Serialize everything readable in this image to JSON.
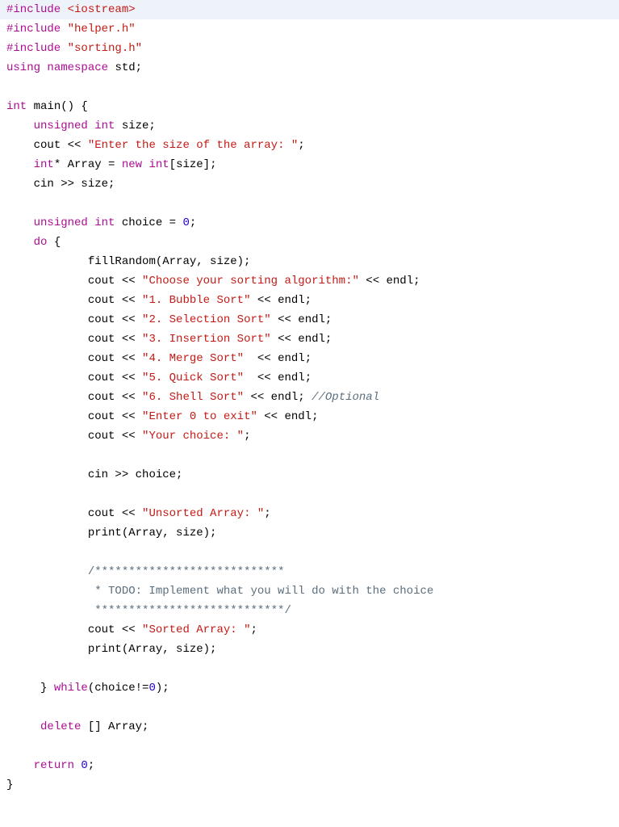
{
  "code": {
    "l1_pre": "#include ",
    "l1_inc": "<iostream>",
    "l2_pre": "#include ",
    "l2_inc": "\"helper.h\"",
    "l3_pre": "#include ",
    "l3_inc": "\"sorting.h\"",
    "l4_using": "using ",
    "l4_namespace": "namespace ",
    "l4_std": "std;",
    "l6_int": "int ",
    "l6_main": "main() {",
    "l7_indent": "    ",
    "l7_unsigned": "unsigned int ",
    "l7_size": "size;",
    "l8_indent": "    ",
    "l8_cout": "cout << ",
    "l8_str": "\"Enter the size of the array: \"",
    "l8_end": ";",
    "l9_indent": "    ",
    "l9_int": "int",
    "l9_star": "* Array = ",
    "l9_new": "new ",
    "l9_int2": "int",
    "l9_brackets": "[size];",
    "l10_indent": "    ",
    "l10_cin": "cin >> size;",
    "l12_indent": "    ",
    "l12_unsigned": "unsigned int ",
    "l12_choice": "choice = ",
    "l12_zero": "0",
    "l12_semi": ";",
    "l13_indent": "    ",
    "l13_do": "do ",
    "l13_brace": "{",
    "l14_indent": "            ",
    "l14_fill": "fillRandom(Array, size);",
    "l15_indent": "            ",
    "l15_cout": "cout << ",
    "l15_str": "\"Choose your sorting algorithm:\"",
    "l15_endl": " << endl;",
    "l16_indent": "            ",
    "l16_cout": "cout << ",
    "l16_str": "\"1. Bubble Sort\"",
    "l16_endl": " << endl;",
    "l17_indent": "            ",
    "l17_cout": "cout << ",
    "l17_str": "\"2. Selection Sort\"",
    "l17_endl": " << endl;",
    "l18_indent": "            ",
    "l18_cout": "cout << ",
    "l18_str": "\"3. Insertion Sort\"",
    "l18_endl": " << endl;",
    "l19_indent": "            ",
    "l19_cout": "cout << ",
    "l19_str": "\"4. Merge Sort\"",
    "l19_endl": "  << endl;",
    "l20_indent": "            ",
    "l20_cout": "cout << ",
    "l20_str": "\"5. Quick Sort\"",
    "l20_endl": "  << endl;",
    "l21_indent": "            ",
    "l21_cout": "cout << ",
    "l21_str": "\"6. Shell Sort\"",
    "l21_endl": " << endl; ",
    "l21_comment": "//Optional",
    "l22_indent": "            ",
    "l22_cout": "cout << ",
    "l22_str": "\"Enter 0 to exit\"",
    "l22_endl": " << endl;",
    "l23_indent": "            ",
    "l23_cout": "cout << ",
    "l23_str": "\"Your choice: \"",
    "l23_end": ";",
    "l25_indent": "            ",
    "l25_cin": "cin >> choice;",
    "l27_indent": "            ",
    "l27_cout": "cout << ",
    "l27_str": "\"Unsorted Array: \"",
    "l27_end": ";",
    "l28_indent": "            ",
    "l28_print": "print(Array, size);",
    "l30_indent": "            ",
    "l30_c1": "/****************************",
    "l31_indent": "             ",
    "l31_c2": "* TODO: Implement what you will do with the choice",
    "l32_indent": "             ",
    "l32_c3": "****************************/",
    "l33_indent": "            ",
    "l33_cout": "cout << ",
    "l33_str": "\"Sorted Array: \"",
    "l33_end": ";",
    "l34_indent": "            ",
    "l34_print": "print(Array, size);",
    "l36_indent": "     ",
    "l36_brace": "} ",
    "l36_while": "while",
    "l36_cond": "(choice!=",
    "l36_zero": "0",
    "l36_end": ");",
    "l38_indent": "     ",
    "l38_delete": "delete ",
    "l38_arr": "[] Array;",
    "l40_indent": "    ",
    "l40_return": "return ",
    "l40_zero": "0",
    "l40_semi": ";",
    "l41_brace": "}"
  }
}
